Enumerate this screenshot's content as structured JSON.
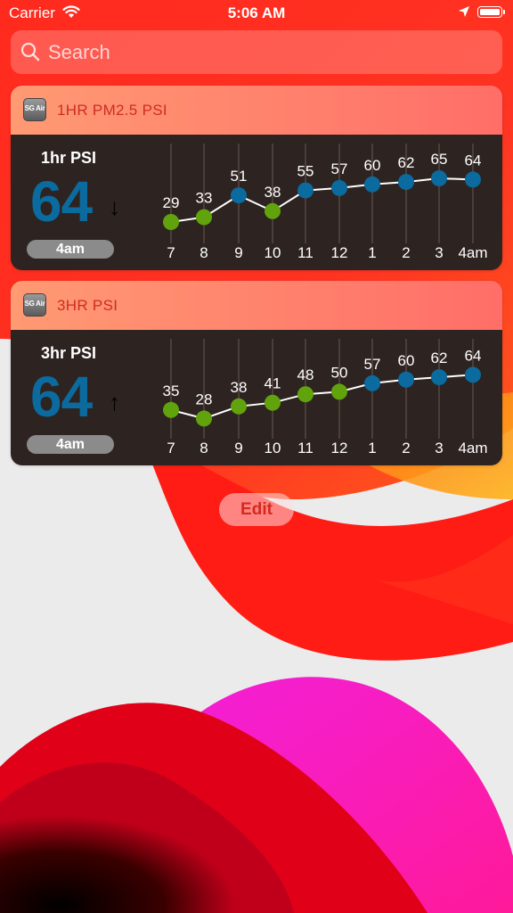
{
  "status_bar": {
    "carrier": "Carrier",
    "time": "5:06 AM"
  },
  "search": {
    "placeholder": "Search"
  },
  "colors": {
    "good": "#61a30d",
    "moderate": "#0b6a9e",
    "accent": "#d5291d"
  },
  "widgets": [
    {
      "title": "1HR PM2.5 PSI",
      "icon_text": "SG Air",
      "label": "1hr PSI",
      "value": "64",
      "arrow": "↓",
      "time": "4am",
      "chart_data": {
        "type": "line",
        "categories": [
          "7",
          "8",
          "9",
          "10",
          "11",
          "12",
          "1",
          "2",
          "3",
          "4am"
        ],
        "values": [
          29,
          33,
          51,
          38,
          55,
          57,
          60,
          62,
          65,
          64
        ]
      }
    },
    {
      "title": "3HR PSI",
      "icon_text": "SG Air",
      "label": "3hr PSI",
      "value": "64",
      "arrow": "↑",
      "time": "4am",
      "chart_data": {
        "type": "line",
        "categories": [
          "7",
          "8",
          "9",
          "10",
          "11",
          "12",
          "1",
          "2",
          "3",
          "4am"
        ],
        "values": [
          35,
          28,
          38,
          41,
          48,
          50,
          57,
          60,
          62,
          64
        ]
      }
    }
  ],
  "edit_button": {
    "label": "Edit"
  }
}
